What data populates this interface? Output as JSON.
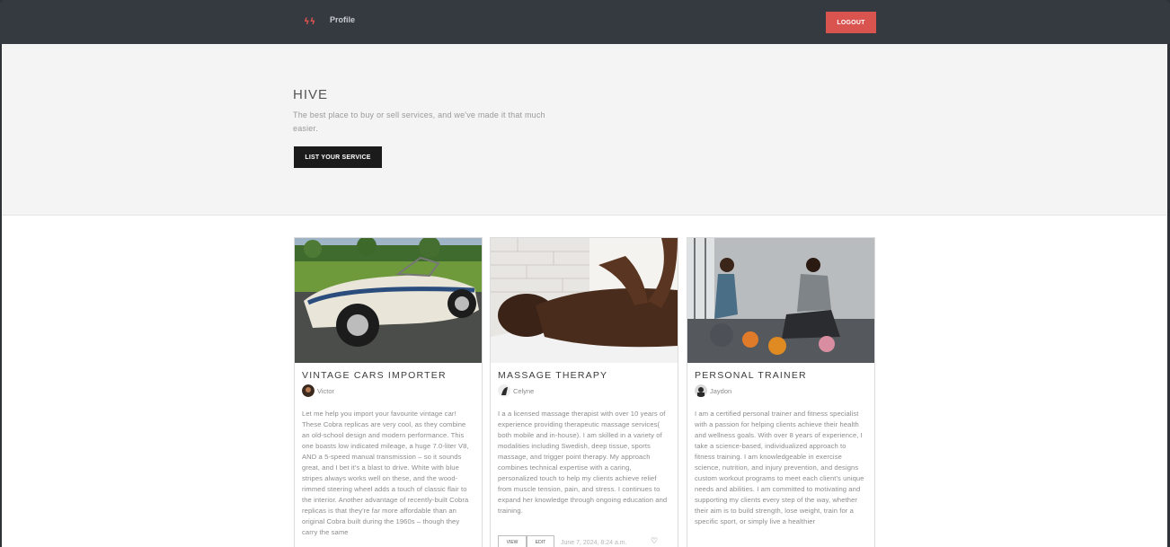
{
  "nav": {
    "logo_glyph": "ϟϟ",
    "profile_label": "Profile",
    "logout_label": "LOGOUT"
  },
  "hero": {
    "title": "HIVE",
    "subtitle": "The best place to buy or sell services, and we've made it that much easier.",
    "button_label": "LIST YOUR SERVICE"
  },
  "cards": [
    {
      "title": "VINTAGE CARS IMPORTER",
      "author": "Victor",
      "description": "Let me help you import your favourite vintage car! These Cobra replicas are very cool, as they combine an old-school design and modern performance. This one boasts low indicated mileage, a huge 7.0-liter V8, AND a 5-speed manual transmission – so it sounds great, and I bet it's a blast to drive. White with blue stripes always works well on these, and the wood-rimmed steering wheel adds a touch of classic flair to the interior. Another advantage of recently-built Cobra replicas is that they're far more affordable than an original Cobra built during the 1960s – though they carry the same"
    },
    {
      "title": "MASSAGE THERAPY",
      "author": "Celyne",
      "description": "I a a licensed massage therapist with over 10 years of experience providing therapeutic massage services( both mobile and in-house). I am skilled in a variety of modalities including Swedish, deep tissue, sports massage, and trigger point therapy. My approach combines technical expertise with a caring, personalized touch to help my clients achieve relief from muscle tension, pain, and stress. I continues to expand her knowledge through ongoing education and training.",
      "view_label": "VIEW",
      "edit_label": "EDIT",
      "date": "June 7, 2024, 8:24 a.m.",
      "heart_glyph": "♡"
    },
    {
      "title": "PERSONAL TRAINER",
      "author": "Jaydon",
      "description": "I am a certified personal trainer and fitness specialist with a passion for helping clients achieve their health and wellness goals. With over 8 years of experience, I take a science-based, individualized approach to fitness training. I am knowledgeable in exercise science, nutrition, and injury prevention, and designs custom workout programs to meet each client's unique needs and abilities. I am committed to motivating and supporting my clients every step of the way, whether their aim is to build strength, lose weight, train for a specific sport, or simply live a healthier"
    }
  ],
  "colors": {
    "accent": "#d9534f",
    "navbar": "#353a41",
    "hero_bg": "#f4f4f4",
    "dark_button": "#1b1b1b"
  },
  "icons": [
    "brand-logo-icon",
    "heart-icon"
  ]
}
